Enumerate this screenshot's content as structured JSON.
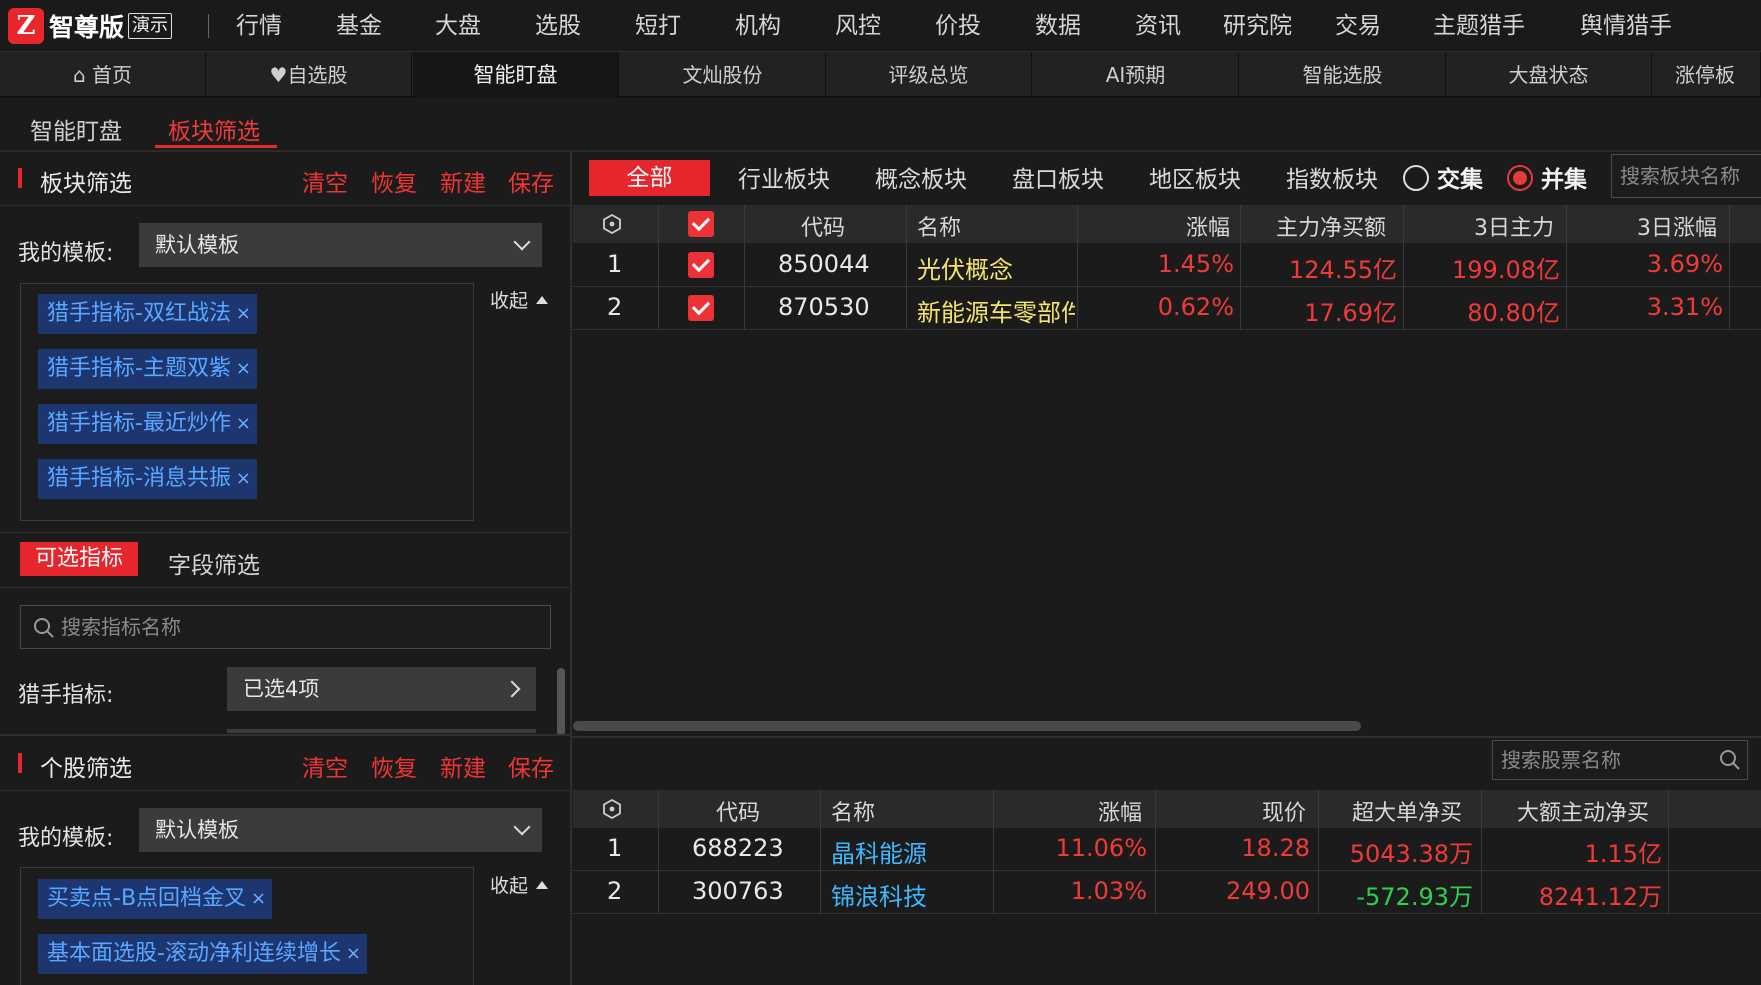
{
  "app": {
    "brand_mark": "Z",
    "brand": "智尊版",
    "demo": "演示"
  },
  "top_menu": [
    "行情",
    "基金",
    "大盘",
    "选股",
    "短打",
    "机构",
    "风控",
    "价投",
    "数据",
    "资讯",
    "研究院",
    "交易",
    "主题猎手",
    "舆情猎手"
  ],
  "tabs": [
    "首页",
    "自选股",
    "智能盯盘",
    "文灿股份",
    "评级总览",
    "AI预期",
    "智能选股",
    "大盘状态",
    "涨停板"
  ],
  "subtabs": [
    "智能盯盘",
    "板块筛选"
  ],
  "actions": {
    "clear": "清空",
    "restore": "恢复",
    "new": "新建",
    "save": "保存"
  },
  "sector_filter": {
    "title": "板块筛选",
    "my_template_label": "我的模板:",
    "template_value": "默认模板",
    "collapse": "收起",
    "tags": [
      "猎手指标-双红战法",
      "猎手指标-主题双紫",
      "猎手指标-最近炒作",
      "猎手指标-消息共振"
    ],
    "tabs": [
      "可选指标",
      "字段筛选"
    ],
    "search_placeholder": "搜索指标名称",
    "hunter_label": "猎手指标:",
    "hunter_value": "已选4项"
  },
  "stock_filter": {
    "title": "个股筛选",
    "my_template_label": "我的模板:",
    "template_value": "默认模板",
    "collapse": "收起",
    "tags": [
      "买卖点-B点回档金叉",
      "基本面选股-滚动净利连续增长"
    ]
  },
  "sector_categories": [
    "全部",
    "行业板块",
    "概念板块",
    "盘口板块",
    "地区板块",
    "指数板块"
  ],
  "set_mode": {
    "intersection": "交集",
    "union": "并集",
    "selected": "并集"
  },
  "sector_search_placeholder": "搜索板块名称",
  "sector_table": {
    "headers": [
      "代码",
      "名称",
      "涨幅",
      "主力净买额",
      "3日主力",
      "3日涨幅"
    ],
    "rows": [
      {
        "idx": "1",
        "code": "850044",
        "name": "光伏概念",
        "chg": "1.45%",
        "net": "124.55亿",
        "main3": "199.08亿",
        "chg3": "3.69%"
      },
      {
        "idx": "2",
        "code": "870530",
        "name": "新能源车零部件",
        "chg": "0.62%",
        "net": "17.69亿",
        "main3": "80.80亿",
        "chg3": "3.31%"
      }
    ]
  },
  "stock_search_placeholder": "搜索股票名称",
  "stock_table": {
    "headers": [
      "代码",
      "名称",
      "涨幅",
      "现价",
      "超大单净买",
      "大额主动净买"
    ],
    "rows": [
      {
        "idx": "1",
        "code": "688223",
        "name": "晶科能源",
        "chg": "11.06%",
        "price": "18.28",
        "xl": "5043.38万",
        "big": "1.15亿"
      },
      {
        "idx": "2",
        "code": "300763",
        "name": "锦浪科技",
        "chg": "1.03%",
        "price": "249.00",
        "xl": "-572.93万",
        "big": "8241.12万"
      }
    ]
  },
  "colors": {
    "accent": "#e5262c",
    "up": "#f03a3a",
    "down": "#2bd34c",
    "tag_bg": "#1d3670",
    "tag_text": "#5aa7ff"
  }
}
